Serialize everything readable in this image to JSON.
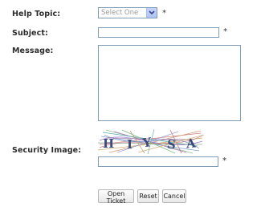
{
  "form": {
    "help_topic": {
      "label": "Help Topic:",
      "selected": "Select One",
      "required": "*"
    },
    "subject": {
      "label": "Subject:",
      "value": "",
      "required": "*"
    },
    "message": {
      "label": "Message:",
      "value": ""
    },
    "security": {
      "label": "Security Image:",
      "captcha_text": "HIYSA",
      "value": "",
      "required": "*"
    }
  },
  "buttons": {
    "open_ticket": "Open Ticket",
    "reset": "Reset",
    "cancel": "Cancel"
  },
  "colors": {
    "input_border": "#7f9db9",
    "select_button": "#b0c4f2",
    "captcha_text": "#3b4a7a"
  },
  "icons": {
    "dropdown": "chevron-down-icon"
  }
}
